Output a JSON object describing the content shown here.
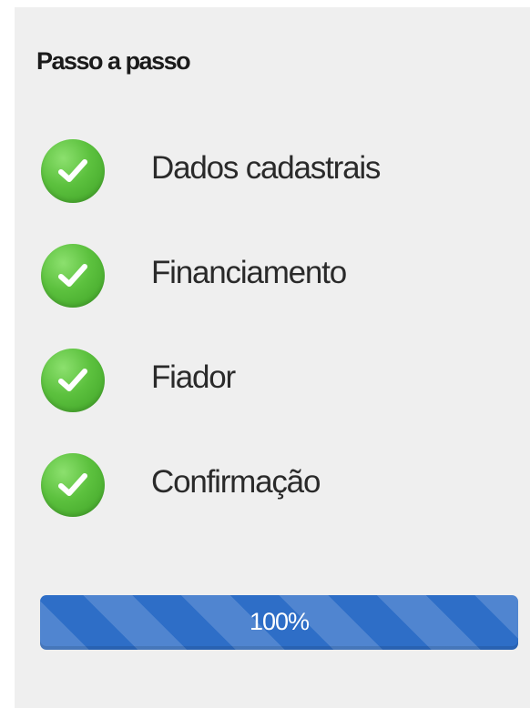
{
  "panel": {
    "title": "Passo a passo"
  },
  "steps": [
    {
      "label": "Dados cadastrais",
      "icon": "check-circle-icon",
      "status": "complete"
    },
    {
      "label": "Financiamento",
      "icon": "check-circle-icon",
      "status": "complete"
    },
    {
      "label": "Fiador",
      "icon": "check-circle-icon",
      "status": "complete"
    },
    {
      "label": "Confirmação",
      "icon": "check-circle-icon",
      "status": "complete"
    }
  ],
  "progress": {
    "percent": 100,
    "label": "100%"
  },
  "colors": {
    "panel_background": "#efefef",
    "check_green": "#5cc13e",
    "progress_blue": "#2e6ec7"
  }
}
